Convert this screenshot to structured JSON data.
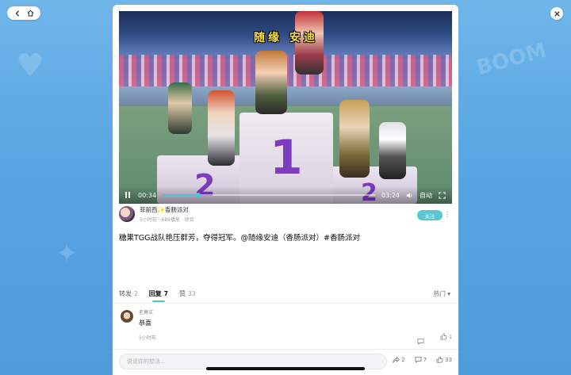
{
  "window": {
    "nav": {
      "back_icon": "chevron-left-icon",
      "home_icon": "home-icon"
    },
    "close_icon": "close-icon"
  },
  "video": {
    "caption": "随缘 安迪",
    "time_current": "00:34",
    "time_total": "03:24",
    "progress": 0.167,
    "auto_label": "自动",
    "podium_numbers": [
      "2",
      "1",
      "2"
    ]
  },
  "author": {
    "name": "菲丽西✨香肠派对",
    "meta": "5小时前 · 689播放 · 综合",
    "follow_label": "关注",
    "more": "⋮"
  },
  "post": {
    "text": "糖果TGG战队艳压群芳，夺得冠军。@随缘安迪（香肠派对）#香肠派对"
  },
  "tabs": [
    {
      "label": "转发",
      "count": "2"
    },
    {
      "label": "回复",
      "count": "7",
      "active": true
    },
    {
      "label": "赞",
      "count": "33"
    }
  ],
  "sort_label": "热门",
  "comment": {
    "user": "老莫买",
    "text": "恭喜",
    "time": "5小时前",
    "likes": "1"
  },
  "bottom_bar": {
    "placeholder": "说说你的想法...",
    "share_count": "2",
    "comment_count": "7",
    "like_count": "33"
  },
  "colors": {
    "accent": "#4ec3d4",
    "follow_button": "#5cc5d3",
    "background": "#5aa6e2"
  }
}
